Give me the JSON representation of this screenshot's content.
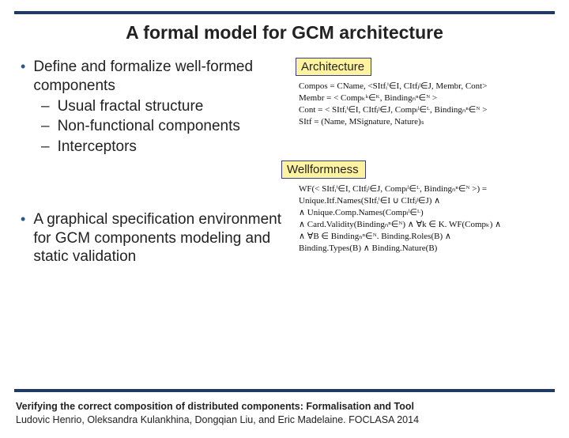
{
  "title": "A formal model for GCM architecture",
  "bullets": {
    "b1_line": "Define and formalize well-formed components",
    "b1_sub1": "Usual fractal structure",
    "b1_sub2": "Non-functional components",
    "b1_sub3": "Interceptors",
    "b2_line": "A graphical specification environment for GCM components modeling and static validation"
  },
  "tags": {
    "architecture": "Architecture",
    "wellformness": "Wellformness"
  },
  "formulas": {
    "arch_l1": "Compos = CName, <SItfᵢⁱ∈I, CItfⱼʲ∈J, Membr, Cont>",
    "arch_l2": "Membr = < Compₖᵏ∈ᴷ, Bindingₙⁿ∈ᴺ >",
    "arch_l3": "Cont = < SItfᵢⁱ∈I, CItfⱼʲ∈J, Compₗˡ∈ᴸ, Bindingₙⁿ∈ᴺ >",
    "arch_l4": "SItf = (Name, MSignature, Nature)ₛ",
    "wf_l1": "WF(< SItfᵢⁱ∈I, CItfⱼʲ∈J, Compₗˡ∈ᴸ, Bindingₙⁿ∈ᴺ >) =",
    "wf_l2": "  Unique.Itf.Names(SItfᵢⁱ∈I ∪ CItfⱼʲ∈J) ∧",
    "wf_l3": "∧ Unique.Comp.Names(Compₗˡ∈ᴸ)",
    "wf_l4": "∧ Card.Validity(Bindingₙⁿ∈ᴺ) ∧ ∀k ∈ K. WF(Compₖ) ∧",
    "wf_l5": "∧ ∀B ∈ Bindingₙⁿ∈ᴺ. Binding.Roles(B) ∧",
    "wf_l6": "   Binding.Types(B) ∧ Binding.Nature(B)"
  },
  "footer": {
    "title": "Verifying the correct composition of distributed components: Formalisation and Tool",
    "authors": "Ludovic Henrio, Oleksandra Kulankhina, Dongqian Liu, and Eric Madelaine.  FOCLASA 2014"
  }
}
